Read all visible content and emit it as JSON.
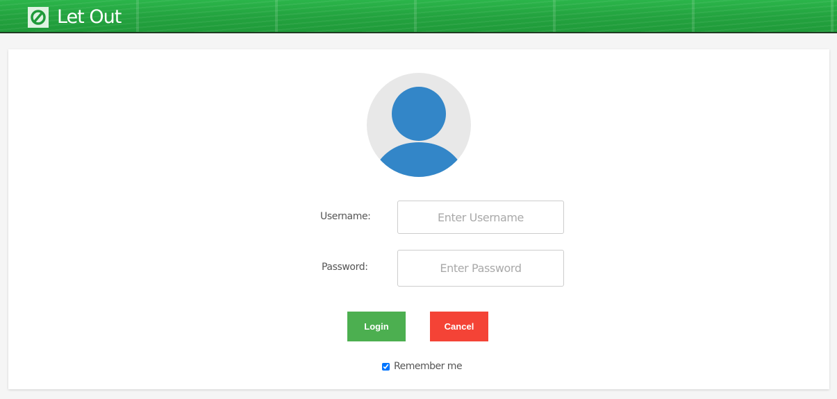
{
  "app": {
    "title": "Let Out",
    "logo_icon": "letout-logo-icon"
  },
  "colors": {
    "header_green": "#23a33f",
    "avatar_blue": "#3386c8",
    "avatar_bg": "#e8e8e8",
    "login_button": "#4caf50",
    "cancel_button": "#f44336"
  },
  "login_form": {
    "avatar_icon": "user-avatar-icon",
    "username_label": "Username:",
    "username_placeholder": "Enter Username",
    "username_value": "",
    "password_label": "Password:",
    "password_placeholder": "Enter Password",
    "password_value": "",
    "login_label": "Login",
    "cancel_label": "Cancel",
    "remember_label": "Remember me",
    "remember_checked": true
  }
}
